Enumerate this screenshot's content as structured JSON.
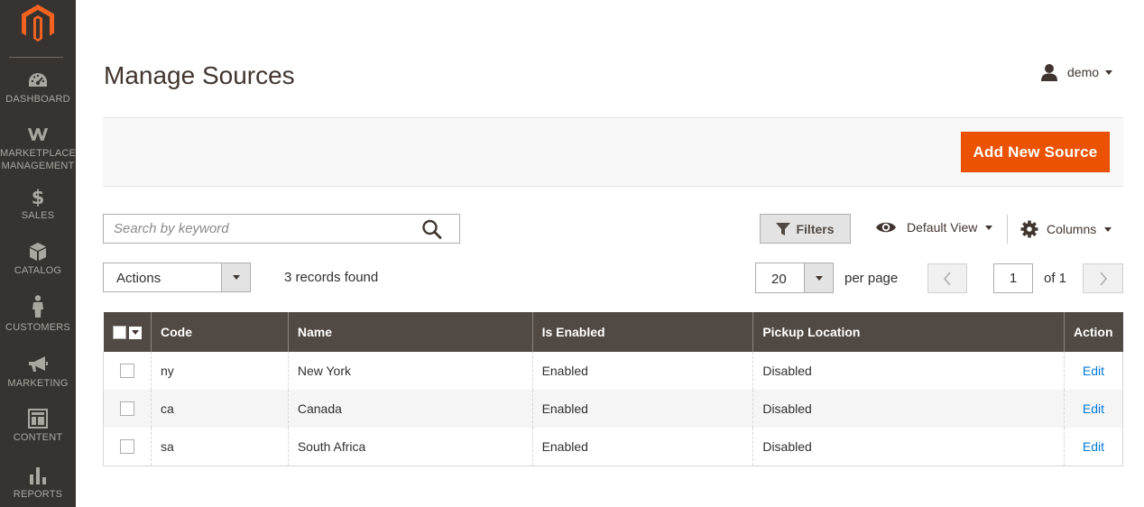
{
  "sidebar": {
    "logo": "magento-logo",
    "items": [
      {
        "icon": "dashboard-icon",
        "label": "DASHBOARD"
      },
      {
        "icon": "marketplace-icon",
        "label_line1": "MARKETPLACE",
        "label_line2": "MANAGEMENT"
      },
      {
        "icon": "dollar-icon",
        "label": "SALES"
      },
      {
        "icon": "box-icon",
        "label": "CATALOG"
      },
      {
        "icon": "person-icon",
        "label": "CUSTOMERS"
      },
      {
        "icon": "megaphone-icon",
        "label": "MARKETING"
      },
      {
        "icon": "layout-icon",
        "label": "CONTENT"
      },
      {
        "icon": "bar-chart-icon",
        "label": "REPORTS"
      }
    ]
  },
  "header": {
    "title": "Manage Sources",
    "user": "demo"
  },
  "action_bar": {
    "add_button": "Add New Source"
  },
  "toolbar": {
    "search_placeholder": "Search by keyword",
    "filters_label": "Filters",
    "view_label": "Default View",
    "columns_label": "Columns",
    "actions_label": "Actions",
    "records_found": "3 records found",
    "per_page_value": "20",
    "per_page_label": "per page",
    "current_page": "1",
    "page_total": "of 1"
  },
  "table": {
    "headers": [
      "Code",
      "Name",
      "Is Enabled",
      "Pickup Location",
      "Action"
    ],
    "rows": [
      {
        "code": "ny",
        "name": "New York",
        "enabled": "Enabled",
        "pickup": "Disabled",
        "action": "Edit"
      },
      {
        "code": "ca",
        "name": "Canada",
        "enabled": "Enabled",
        "pickup": "Disabled",
        "action": "Edit"
      },
      {
        "code": "sa",
        "name": "South Africa",
        "enabled": "Enabled",
        "pickup": "Disabled",
        "action": "Edit"
      }
    ]
  },
  "colors": {
    "sidebar_bg": "#373330",
    "accent": "#eb5202",
    "table_header_bg": "#514943",
    "link": "#007bdb"
  }
}
